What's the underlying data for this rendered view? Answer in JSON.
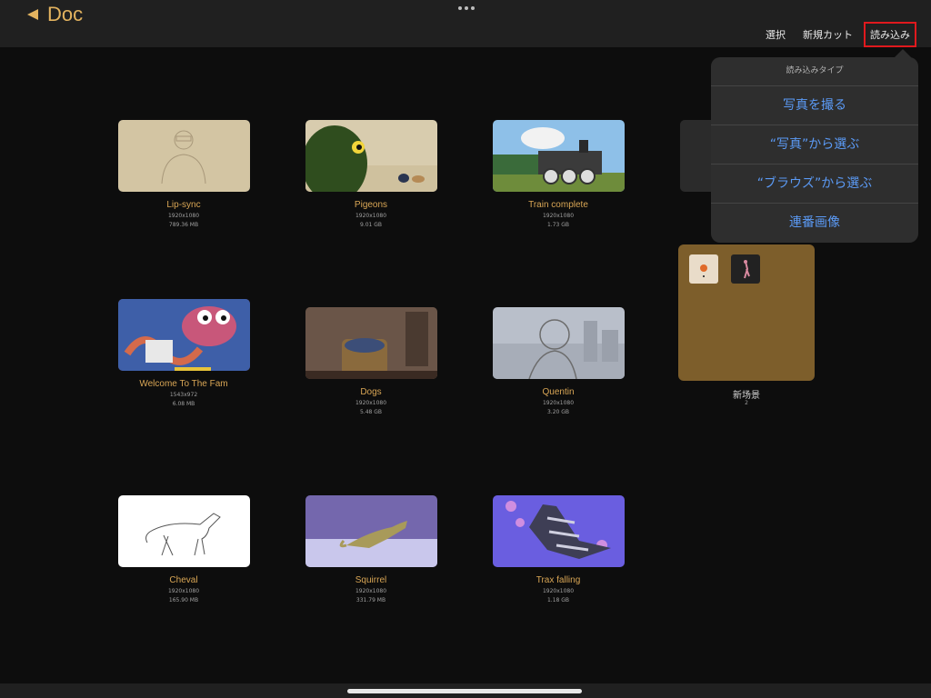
{
  "nav": {
    "back_label": "Doc"
  },
  "toolbar": {
    "select_label": "選択",
    "new_cut_label": "新規カット",
    "import_label": "読み込み"
  },
  "projects": [
    {
      "name": "Lip-sync",
      "resolution": "1920x1080",
      "size": "789.36 MB"
    },
    {
      "name": "Pigeons",
      "resolution": "1920x1080",
      "size": "9.01 GB"
    },
    {
      "name": "Train complete",
      "resolution": "1920x1080",
      "size": "1.73 GB"
    },
    {
      "name": "Welcome To The Fam",
      "resolution": "1543x972",
      "size": "6.08 MB"
    },
    {
      "name": "Dogs",
      "resolution": "1920x1080",
      "size": "5.48 GB"
    },
    {
      "name": "Quentin",
      "resolution": "1920x1080",
      "size": "3.20 GB"
    },
    {
      "name": "Cheval",
      "resolution": "1920x1080",
      "size": "165.90 MB"
    },
    {
      "name": "Squirrel",
      "resolution": "1920x1080",
      "size": "331.79 MB"
    },
    {
      "name": "Trax falling",
      "resolution": "1920x1080",
      "size": "1.18 GB"
    }
  ],
  "folder": {
    "name": "新场景",
    "count": "2"
  },
  "import_menu": {
    "title": "読み込みタイプ",
    "items": [
      "写真を撮る",
      "“写真”から選ぶ",
      "“ブラウズ”から選ぶ",
      "連番画像"
    ]
  },
  "colors": {
    "accent": "#e3b35f",
    "menu_link": "#5b9af5",
    "highlight_box": "#e0191d"
  }
}
